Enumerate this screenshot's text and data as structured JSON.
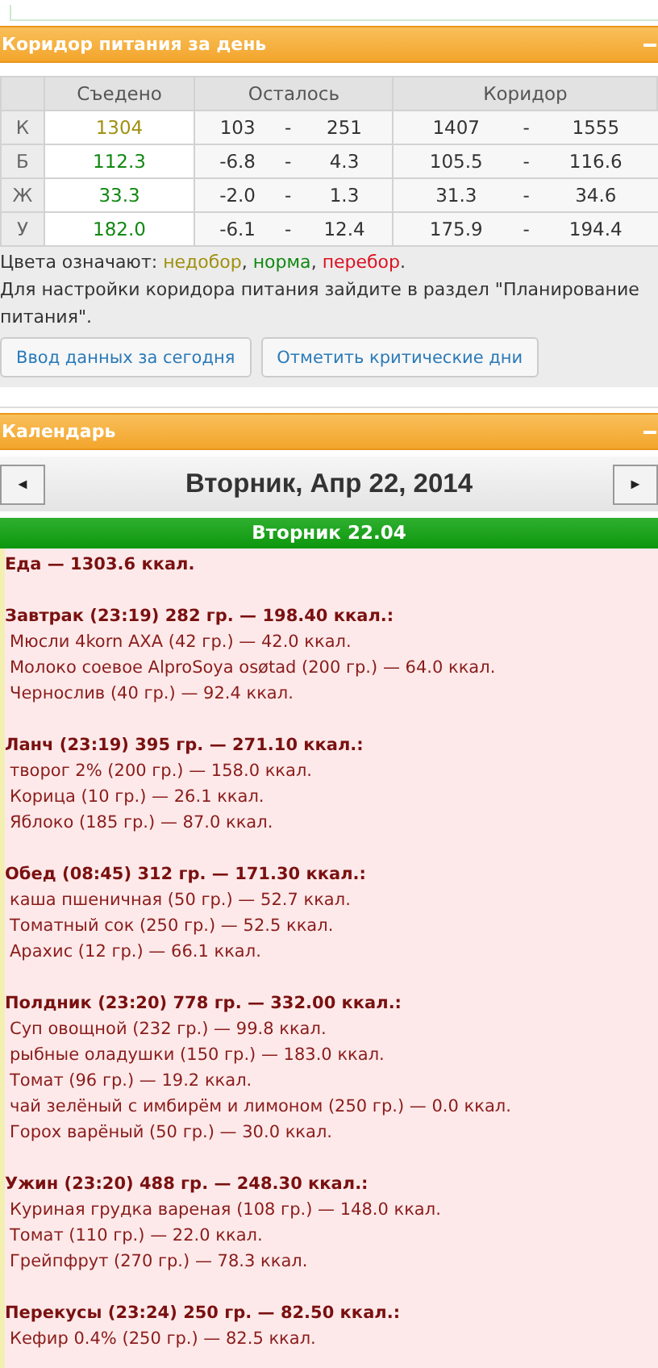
{
  "corridor": {
    "title": "Коридор питания за день",
    "columns": [
      "Съедено",
      "Осталось",
      "Коридор"
    ],
    "rows": [
      {
        "label": "К",
        "eaten": "1304",
        "color": "#a09010",
        "left_min": "103",
        "left_sep": "-",
        "left_max": "251",
        "range_min": "1407",
        "range_sep": "-",
        "range_max": "1555"
      },
      {
        "label": "Б",
        "eaten": "112.3",
        "color": "#118811",
        "left_min": "-6.8",
        "left_sep": "-",
        "left_max": "4.3",
        "range_min": "105.5",
        "range_sep": "-",
        "range_max": "116.6"
      },
      {
        "label": "Ж",
        "eaten": "33.3",
        "color": "#118811",
        "left_min": "-2.0",
        "left_sep": "-",
        "left_max": "1.3",
        "range_min": "31.3",
        "range_sep": "-",
        "range_max": "34.6"
      },
      {
        "label": "У",
        "eaten": "182.0",
        "color": "#118811",
        "left_min": "-6.1",
        "left_sep": "-",
        "left_max": "12.4",
        "range_min": "175.9",
        "range_sep": "-",
        "range_max": "194.4"
      }
    ],
    "legend": [
      {
        "text": "Цвета означают: "
      },
      {
        "text": "недобор",
        "color": "#a09010"
      },
      {
        "text": ", "
      },
      {
        "text": "норма",
        "color": "#118811"
      },
      {
        "text": ", "
      },
      {
        "text": "перебор",
        "color": "#dd1122"
      },
      {
        "text": "."
      }
    ],
    "hint": "Для настройки коридора питания зайдите в раздел \"Планирование питания\".",
    "buttons": [
      "Ввод данных за сегодня",
      "Отметить критические дни"
    ]
  },
  "calendar": {
    "title": "Календарь",
    "prev": "◄",
    "date": "Вторник, Апр 22, 2014",
    "next": "►",
    "day": "Вторник 22.04",
    "total": "Еда — 1303.6 ккал.",
    "meals": [
      {
        "title": "Завтрак (23:19) 282 гр. — 198.40 ккал.:",
        "items": [
          "Мюсли 4korn AXA (42 гр.) — 42.0 ккал.",
          "Молоко соевое AlproSoya osøtad (200 гр.) — 64.0 ккал.",
          "Чернослив (40 гр.) — 92.4 ккал."
        ]
      },
      {
        "title": "Ланч (23:19) 395 гр. — 271.10 ккал.:",
        "items": [
          "творог 2% (200 гр.) — 158.0 ккал.",
          "Корица (10 гр.) — 26.1 ккал.",
          "Яблоко (185 гр.) — 87.0 ккал."
        ]
      },
      {
        "title": "Обед (08:45) 312 гр. — 171.30 ккал.:",
        "items": [
          "каша пшеничная (50 гр.) — 52.7 ккал.",
          "Томатный сок (250 гр.) — 52.5 ккал.",
          "Арахис (12 гр.) — 66.1 ккал."
        ]
      },
      {
        "title": "Полдник (23:20) 778 гр. — 332.00 ккал.:",
        "items": [
          "Суп овощной (232 гр.) — 99.8 ккал.",
          "рыбные оладушки (150 гр.) — 183.0 ккал.",
          "Томат (96 гр.) — 19.2 ккал.",
          "чай зелёный с имбирём и лимоном (250 гр.) — 0.0 ккал.",
          "Горох варёный (50 гр.) — 30.0 ккал."
        ]
      },
      {
        "title": "Ужин (23:20) 488 гр. — 248.30 ккал.:",
        "items": [
          "Куриная грудка вареная (108 гр.) — 148.0 ккал.",
          "Томат (110 гр.) — 22.0 ккал.",
          "Грейпфрут (270 гр.) — 78.3 ккал."
        ]
      },
      {
        "title": "Перекусы (23:24) 250 гр. — 82.50 ккал.:",
        "items": [
          "Кефир 0.4% (250 гр.) — 82.5 ккал."
        ]
      }
    ]
  }
}
